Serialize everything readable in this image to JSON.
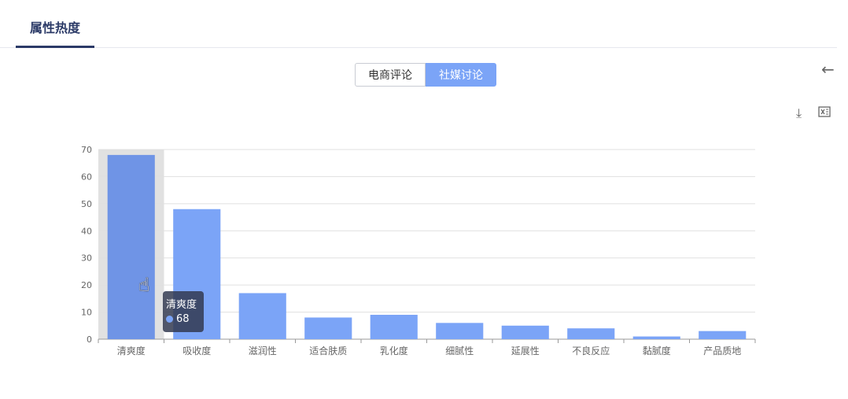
{
  "tabs": [
    {
      "label": "属性热度"
    }
  ],
  "toggle": {
    "options": [
      "电商评论",
      "社媒讨论"
    ],
    "selected": "社媒讨论"
  },
  "toolbar": {
    "back_icon": "arrow-left-icon",
    "download_icon": "download-icon",
    "excel_icon": "excel-icon"
  },
  "colors": {
    "accent": "#7ba4f7",
    "tab": "#2b3a67",
    "tooltip_bg": "#323a50"
  },
  "chart_data": {
    "type": "bar",
    "categories": [
      "清爽度",
      "吸收度",
      "滋润性",
      "适合肤质",
      "乳化度",
      "细腻性",
      "延展性",
      "不良反应",
      "黏腻度",
      "产品质地"
    ],
    "values": [
      68,
      48,
      17,
      8,
      9,
      6,
      5,
      4,
      1,
      3
    ],
    "ylim": [
      0,
      70
    ],
    "y_ticks": [
      0,
      10,
      20,
      30,
      40,
      50,
      60,
      70
    ],
    "grid": true,
    "hovered": {
      "category": "清爽度",
      "value": 68
    }
  }
}
